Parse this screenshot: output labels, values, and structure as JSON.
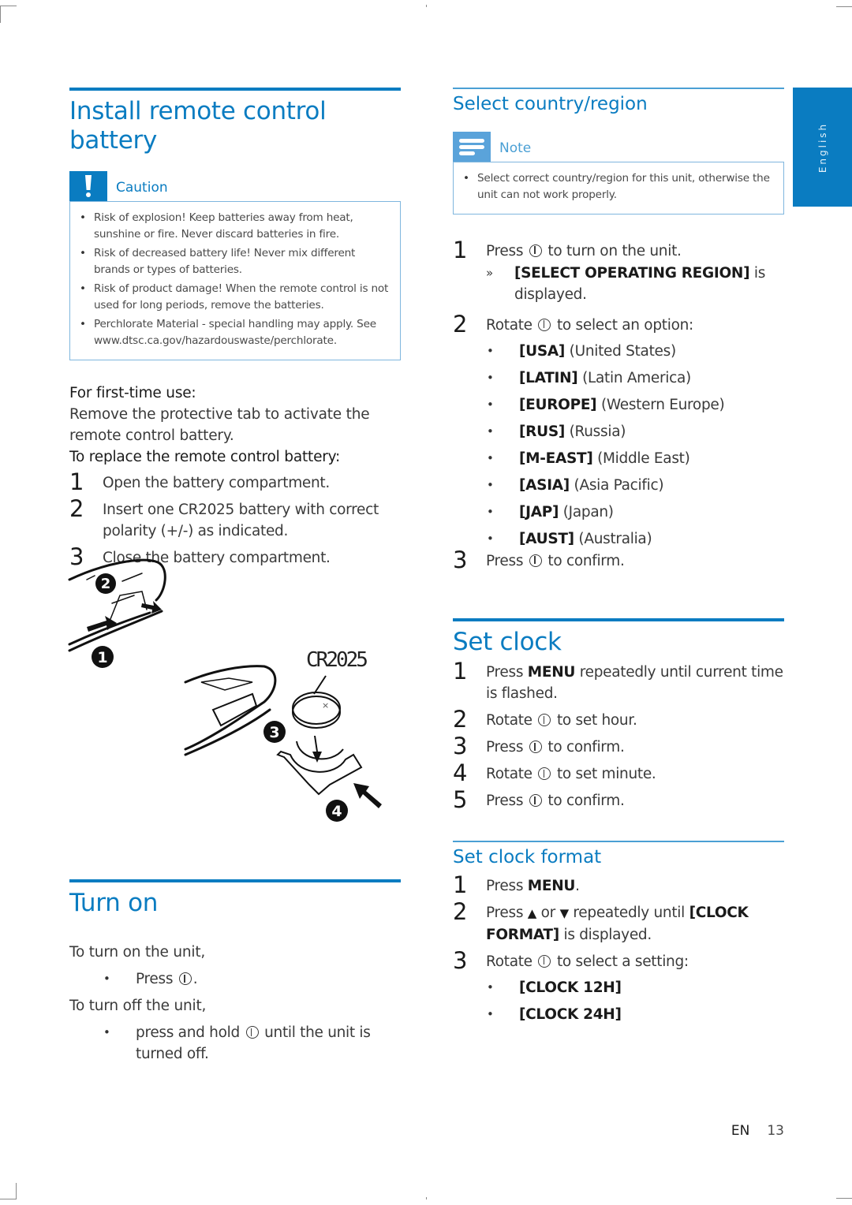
{
  "side_tab": {
    "label": "English"
  },
  "left": {
    "install": {
      "title": "Install remote control battery",
      "caution": {
        "icon": "exclamation-icon",
        "label": "Caution",
        "items": [
          "Risk of explosion! Keep batteries away from heat, sunshine or fire. Never discard batteries in fire.",
          "Risk of decreased battery life! Never mix different brands or types of batteries.",
          "Risk of product damage! When the remote control is not used for long periods, remove the batteries.",
          "Perchlorate Material - special handling may apply. See www.dtsc.ca.gov/hazardouswaste/perchlorate."
        ]
      },
      "first_use_heading": "For first-time use:",
      "first_use_text": "Remove the protective tab to activate the remote control battery.",
      "replace_heading": "To replace the remote control battery:",
      "steps": [
        {
          "num": "1",
          "text": "Open the battery compartment."
        },
        {
          "num": "2",
          "text": "Insert one CR2025 battery with correct polarity (+/-) as indicated."
        },
        {
          "num": "3",
          "text": "Close the battery compartment."
        }
      ],
      "figure": {
        "battery_label": "CR2025",
        "callouts": [
          "1",
          "2",
          "3",
          "4"
        ]
      }
    },
    "turn_on": {
      "title": "Turn on",
      "on_intro": "To turn on the unit,",
      "on_bullet_prefix": "Press",
      "on_bullet_suffix": ".",
      "off_intro": "To turn off the unit,",
      "off_bullet_prefix": "press and hold",
      "off_bullet_suffix": "until the unit is turned off."
    }
  },
  "right": {
    "region": {
      "title": "Select country/region",
      "note": {
        "icon": "note-lines-icon",
        "label": "Note",
        "items": [
          "Select correct country/region for this unit, otherwise the unit can not work properly."
        ]
      },
      "step1_prefix": "Press",
      "step1_suffix": "to turn on the unit.",
      "step1_result_marker": "»",
      "step1_result_bold": "[SELECT OPERATING REGION]",
      "step1_result_text": "is displayed.",
      "step2_prefix": "Rotate",
      "step2_suffix": "to select an option:",
      "options": [
        {
          "code": "[USA]",
          "name": "(United States)"
        },
        {
          "code": "[LATIN]",
          "name": "(Latin America)"
        },
        {
          "code": "[EUROPE]",
          "name": "(Western Europe)"
        },
        {
          "code": "[RUS]",
          "name": "(Russia)"
        },
        {
          "code": "[M-EAST]",
          "name": "(Middle East)"
        },
        {
          "code": "[ASIA]",
          "name": "(Asia Pacific)"
        },
        {
          "code": "[JAP]",
          "name": "(Japan)"
        },
        {
          "code": "[AUST]",
          "name": "(Australia)"
        }
      ],
      "step3_prefix": "Press",
      "step3_suffix": "to confirm."
    },
    "set_clock": {
      "title": "Set clock",
      "step1_prefix": "Press",
      "step1_bold": "MENU",
      "step1_suffix": "repeatedly until current time is flashed.",
      "step2_prefix": "Rotate",
      "step2_suffix": "to set hour.",
      "step3_prefix": "Press",
      "step3_suffix": "to confirm.",
      "step4_prefix": "Rotate",
      "step4_suffix": "to set minute.",
      "step5_prefix": "Press",
      "step5_suffix": "to confirm."
    },
    "clock_format": {
      "title": "Set clock format",
      "step1_prefix": "Press",
      "step1_bold": "MENU",
      "step1_suffix": ".",
      "step2_prefix": "Press",
      "step2_up": "▲",
      "step2_or": "or",
      "step2_down": "▼",
      "step2_mid": "repeatedly until",
      "step2_bold": "[CLOCK FORMAT]",
      "step2_suffix": "is displayed.",
      "step3_prefix": "Rotate",
      "step3_suffix": "to select a setting:",
      "options": [
        "[CLOCK 12H]",
        "[CLOCK 24H]"
      ]
    }
  },
  "footer": {
    "lang": "EN",
    "page": "13"
  }
}
